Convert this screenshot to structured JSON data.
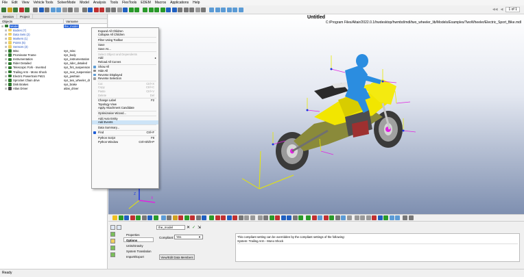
{
  "menubar": [
    "File",
    "Edit",
    "View",
    "Vehicle Tools",
    "SolverMode",
    "Model",
    "Analysis",
    "Tools",
    "FlexTools",
    "EDEM",
    "Macros",
    "Applications",
    "Help"
  ],
  "pager": {
    "page": "1 of 1"
  },
  "left_panel": {
    "tabs": [
      "Session",
      "Project"
    ],
    "columns": [
      "Objects",
      "Varname"
    ],
    "rows": [
      {
        "name": "Model",
        "var": "the_model",
        "level": 0,
        "sel": true,
        "color": "#2f7a2f"
      },
      {
        "name": "Bodies (7)",
        "var": "",
        "level": 1,
        "folder": true
      },
      {
        "name": "Data Sets (2)",
        "var": "",
        "level": 1,
        "folder": true
      },
      {
        "name": "Markers (1)",
        "var": "",
        "level": 1,
        "folder": true
      },
      {
        "name": "Points (5)",
        "var": "",
        "level": 1,
        "folder": true
      },
      {
        "name": "Sensors (3)",
        "var": "",
        "level": 1,
        "folder": true
      },
      {
        "name": "Misc",
        "var": "sys_misc",
        "level": 1,
        "color": "#2f7a2f"
      },
      {
        "name": "Prominator Frame",
        "var": "sys_body",
        "level": 1,
        "color": "#2f7a2f"
      },
      {
        "name": "Instrumentation",
        "var": "sys_instrumentation",
        "level": 1,
        "color": "#2f7a2f"
      },
      {
        "name": "Rider Detailed",
        "var": "sys_rider_detailed",
        "level": 1,
        "color": "#2f7a2f"
      },
      {
        "name": "Telescopic Fork - Inverted",
        "var": "sys_frnt_suspension",
        "level": 1,
        "color": "#2f7a2f"
      },
      {
        "name": "Trailing Arm - Mono Shock",
        "var": "sys_rear_suspension",
        "level": 1,
        "color": "#2f7a2f"
      },
      {
        "name": "Electric Powertrain FMJ1",
        "var": "sys_pwrtrain",
        "level": 1,
        "color": "#2f7a2f"
      },
      {
        "name": "Sprocket Chain drive",
        "var": "sys_two_wheeler_dr",
        "level": 1,
        "color": "#2f7a2f"
      },
      {
        "name": "Disk Brakes",
        "var": "sys_brake",
        "level": 1,
        "color": "#2f7a2f"
      },
      {
        "name": "Atlas Driver",
        "var": "atlas_driver",
        "level": 1,
        "color": "#444444"
      }
    ]
  },
  "viewport": {
    "title": "Untitled",
    "path": "C:/Program Files/Altair/2022.0.1/hwdesktop/hwmbd/mdl/two_wheeler_lib/Models/Examples/TwoWheeler/Electric_Sport_Bike.mdl"
  },
  "context_menu": [
    {
      "label": "Expand All Children",
      "state": "enabled"
    },
    {
      "label": "Collapse All Children",
      "state": "enabled"
    },
    {
      "sep": true
    },
    {
      "label": "Filter Using Toolbar",
      "state": "enabled"
    },
    {
      "sep": true
    },
    {
      "label": "Save",
      "state": "enabled"
    },
    {
      "label": "Save As...",
      "state": "enabled"
    },
    {
      "sep": true
    },
    {
      "label": "Select Object and Dependents",
      "state": "disabled"
    },
    {
      "label": "Add",
      "state": "enabled",
      "sub": true
    },
    {
      "label": "Reload All Curves",
      "state": "enabled"
    },
    {
      "sep": true
    },
    {
      "label": "Show All",
      "state": "enabled",
      "icon": "#5b9bd5"
    },
    {
      "label": "Hide All",
      "state": "enabled",
      "icon": "#888888"
    },
    {
      "label": "Reverse Displayed",
      "state": "enabled",
      "icon": "#5b9bd5"
    },
    {
      "label": "Reverse Selection",
      "state": "enabled",
      "icon": "#a0a0a0"
    },
    {
      "sep": true
    },
    {
      "label": "Cut",
      "state": "disabled",
      "shortcut": "Ctrl+X"
    },
    {
      "label": "Copy",
      "state": "disabled",
      "shortcut": "Ctrl+C"
    },
    {
      "label": "Paste",
      "state": "disabled",
      "shortcut": "Ctrl+V"
    },
    {
      "label": "Delete",
      "state": "disabled",
      "shortcut": "Del"
    },
    {
      "sep": true
    },
    {
      "label": "Change Label",
      "state": "enabled",
      "shortcut": "F2"
    },
    {
      "label": "Topology View",
      "state": "enabled"
    },
    {
      "label": "Apply Attachment Candidate",
      "state": "enabled"
    },
    {
      "sep": true
    },
    {
      "label": "Optimization Wizard...",
      "state": "enabled"
    },
    {
      "sep": true
    },
    {
      "label": "Add Auto Entity",
      "state": "enabled"
    },
    {
      "label": "Add Events",
      "state": "highlighted"
    },
    {
      "sep": true
    },
    {
      "label": "Data Summary...",
      "state": "enabled"
    },
    {
      "sep": true
    },
    {
      "label": "Find",
      "state": "enabled",
      "shortcut": "Ctrl+F",
      "icon": "#1e5dd6"
    },
    {
      "sep": true
    },
    {
      "label": "Python Script",
      "state": "enabled",
      "shortcut": "F8"
    },
    {
      "label": "Python Window",
      "state": "enabled",
      "shortcut": "Ctrl+Shift+P"
    }
  ],
  "lower_panel": {
    "model_name": "the_model",
    "side_buttons": [
      "Properties",
      "Options",
      "Units/Gravity",
      "System Translation",
      "Import/Export"
    ],
    "active_button": "Options",
    "compliant_label": "Compliant:",
    "compliant_value": "Yes",
    "view_edit_button": "View/Edit Data Members",
    "info_line1": "This compliant setting can be overridden by the compliant settings of the following:",
    "info_line2": "System:  Trailing Arm - Mono Shock"
  },
  "statusbar": "Ready",
  "colors": {
    "selection": "#1e5dd6",
    "bike_body": "#f2e600",
    "rider": "#2b8de0",
    "axis_x": "#e022e0",
    "axis_y": "#e8e800",
    "axis_z": "#1a35e0"
  }
}
